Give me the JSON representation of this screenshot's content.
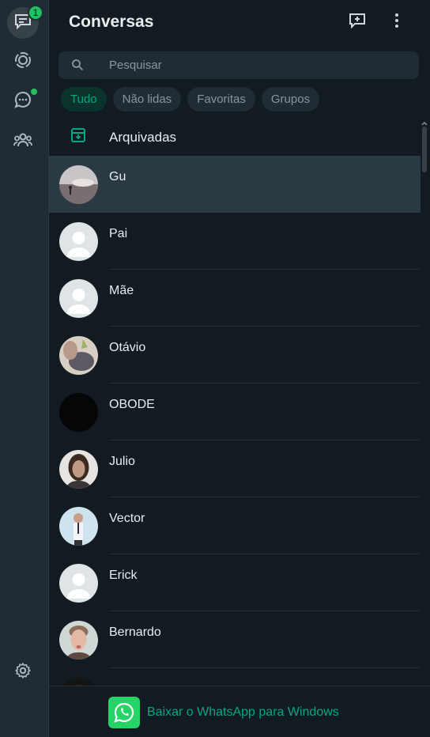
{
  "rail": {
    "chats_badge": "1",
    "items": [
      "chats-icon",
      "status-icon",
      "channels-icon",
      "communities-icon",
      "settings-icon"
    ]
  },
  "header": {
    "title": "Conversas",
    "icons": [
      "new-chat-icon",
      "menu-icon"
    ]
  },
  "search": {
    "placeholder": "Pesquisar"
  },
  "filters": [
    "Tudo",
    "Não lidas",
    "Favoritas",
    "Grupos"
  ],
  "archived": {
    "label": "Arquivadas"
  },
  "chats": [
    {
      "name": "Gu",
      "selected": true
    },
    {
      "name": "Pai"
    },
    {
      "name": "Mãe"
    },
    {
      "name": "Otávio"
    },
    {
      "name": "OBODE"
    },
    {
      "name": "Julio"
    },
    {
      "name": "Vector"
    },
    {
      "name": "Erick"
    },
    {
      "name": "Bernardo"
    }
  ],
  "footer": {
    "text": "Baixar o WhatsApp para Windows"
  },
  "colors": {
    "accent": "#00a884",
    "panel": "#111b21",
    "rail": "#202c33"
  }
}
